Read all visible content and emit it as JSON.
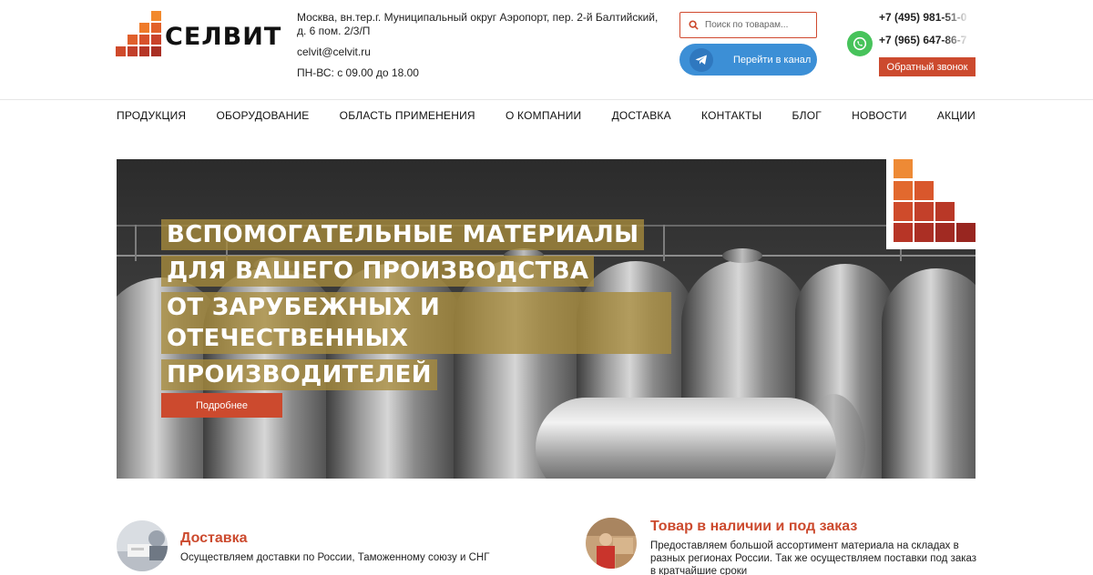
{
  "brand": {
    "name": "СЕЛВИТ"
  },
  "contact": {
    "address": "Москва, вн.тер.г. Муниципальный округ Аэропорт, пер. 2-й Балтийский, д. 6 пом. 2/3/П",
    "email": "celvit@celvit.ru",
    "hours": "ПН-ВС: с 09.00 до 18.00"
  },
  "search": {
    "placeholder": "Поиск по товарам..."
  },
  "telegram": {
    "label": "Перейти в канал"
  },
  "phones": {
    "phone1": "+7 (495) 981-51-0",
    "phone2": "+7 (965) 647-86-7"
  },
  "callback": {
    "label": "Обратный звонок"
  },
  "nav": {
    "items": [
      "ПРОДУКЦИЯ",
      "ОБОРУДОВАНИЕ",
      "ОБЛАСТЬ ПРИМЕНЕНИЯ",
      "О КОМПАНИИ",
      "ДОСТАВКА",
      "КОНТАКТЫ",
      "БЛОГ",
      "НОВОСТИ",
      "АКЦИИ"
    ]
  },
  "hero": {
    "lines": [
      "ВСПОМОГАТЕЛЬНЫЕ МАТЕРИАЛЫ",
      "ДЛЯ ВАШЕГО ПРОИЗВОДСТВА",
      "ОТ ЗАРУБЕЖНЫХ И ОТЕЧЕСТВЕННЫХ",
      "ПРОИЗВОДИТЕЛЕЙ"
    ],
    "button": "Подробнее"
  },
  "features": [
    {
      "title": "Доставка",
      "desc": "Осуществляем доставки по России, Таможенному союзу и СНГ"
    },
    {
      "title": "Товар в наличии и под заказ",
      "desc": "Предоставляем большой ассортимент материала на складах в разных регионах России. Так же осуществляем поставки под заказ в кратчайшие сроки"
    }
  ],
  "colors": {
    "accent": "#cc4a2e",
    "telegram": "#3c8fd6",
    "whatsapp": "#47c35b",
    "headline_bg": "#a88c3c"
  },
  "icons": {
    "search": "search-icon",
    "telegram": "telegram-icon",
    "whatsapp": "whatsapp-icon"
  }
}
